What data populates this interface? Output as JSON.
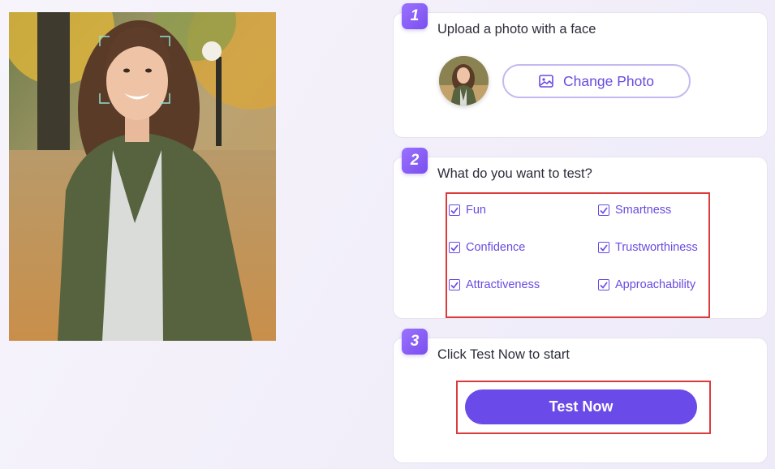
{
  "steps": [
    {
      "number": "1",
      "title": "Upload a photo with a face"
    },
    {
      "number": "2",
      "title": "What do you want to test?"
    },
    {
      "number": "3",
      "title": "Click Test Now to start"
    }
  ],
  "upload": {
    "change_photo_label": "Change Photo",
    "icon": "image-icon"
  },
  "test_options": [
    {
      "label": "Fun",
      "checked": true
    },
    {
      "label": "Smartness",
      "checked": true
    },
    {
      "label": "Confidence",
      "checked": true
    },
    {
      "label": "Trustworthiness",
      "checked": true
    },
    {
      "label": "Attractiveness",
      "checked": true
    },
    {
      "label": "Approachability",
      "checked": true
    }
  ],
  "test_now_label": "Test Now",
  "colors": {
    "accent": "#6a4ae8",
    "highlight_border": "#dc3b3b",
    "badge_gradient_start": "#9a72ff",
    "badge_gradient_end": "#7a4fee"
  }
}
